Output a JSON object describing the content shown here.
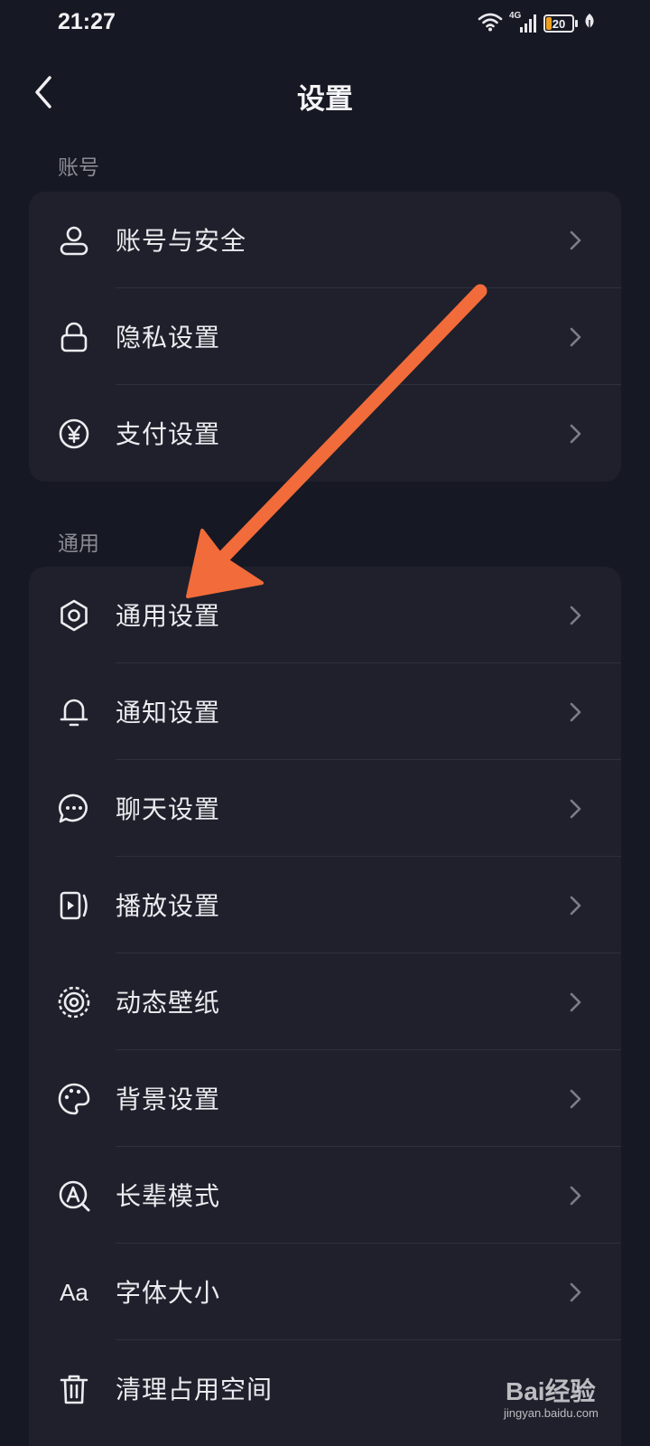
{
  "status_bar": {
    "time": "21:27",
    "network": "4G",
    "battery_level": "20",
    "icons": [
      "wifi-icon",
      "signal-icon",
      "battery-icon",
      "leaf-icon"
    ],
    "battery_color": "#f0a020"
  },
  "header": {
    "title": "设置"
  },
  "sections": [
    {
      "label": "账号",
      "items": [
        {
          "label": "账号与安全",
          "icon": "user-icon"
        },
        {
          "label": "隐私设置",
          "icon": "lock-icon"
        },
        {
          "label": "支付设置",
          "icon": "yen-icon"
        }
      ]
    },
    {
      "label": "通用",
      "items": [
        {
          "label": "通用设置",
          "icon": "gear-icon"
        },
        {
          "label": "通知设置",
          "icon": "bell-icon"
        },
        {
          "label": "聊天设置",
          "icon": "chat-icon"
        },
        {
          "label": "播放设置",
          "icon": "play-icon"
        },
        {
          "label": "动态壁纸",
          "icon": "wallpaper-icon"
        },
        {
          "label": "背景设置",
          "icon": "palette-icon"
        },
        {
          "label": "长辈模式",
          "icon": "elder-mode-icon"
        },
        {
          "label": "字体大小",
          "icon": "font-size-icon",
          "icon_text": "Aa"
        },
        {
          "label": "清理占用空间",
          "icon": "trash-icon"
        }
      ]
    }
  ],
  "annotation": {
    "type": "arrow",
    "color": "#f26b3a",
    "points_to": "通用设置"
  },
  "watermark": {
    "brand": "Bai经验",
    "domain": "jingyan.baidu.com"
  },
  "colors": {
    "background": "#161823",
    "card": "#1f202b",
    "text": "#ececf0",
    "section_label": "#8a8b93"
  }
}
